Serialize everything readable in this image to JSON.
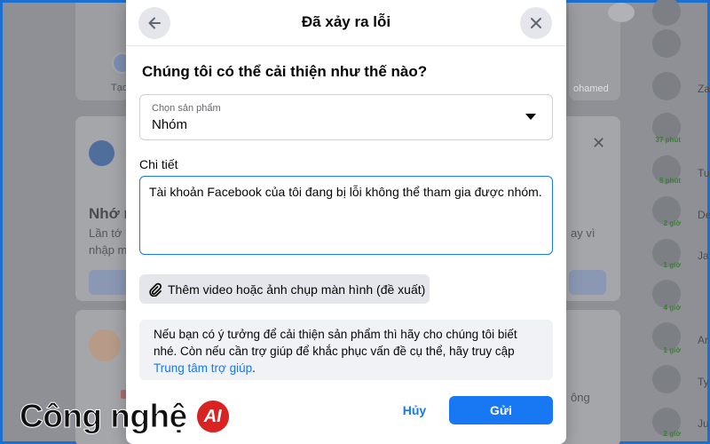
{
  "background": {
    "story_create_label": "Tạo",
    "story_name": "ohamed",
    "card_heading": "Nhớ m",
    "card_line1": "Lần tớ",
    "card_line2": "nhập m",
    "card_side_text": "ay vì",
    "card2_side_text": "ông",
    "contacts": [
      {
        "name": "",
        "time": ""
      },
      {
        "name": "Za",
        "time": ""
      },
      {
        "name": "",
        "time": "37 phút"
      },
      {
        "name": "Tu",
        "time": "5 phút"
      },
      {
        "name": "De",
        "time": "2 giờ"
      },
      {
        "name": "Ja",
        "time": "1 giờ"
      },
      {
        "name": "",
        "time": "4 giờ"
      },
      {
        "name": "Ar",
        "time": "1 giờ"
      },
      {
        "name": "Ty",
        "time": ""
      },
      {
        "name": "Ju",
        "time": "2 giờ"
      }
    ]
  },
  "modal": {
    "title": "Đã xảy ra lỗi",
    "question": "Chúng tôi có thể cải thiện như thế nào?",
    "product_select": {
      "label": "Chọn sản phẩm",
      "value": "Nhóm"
    },
    "details_label": "Chi tiết",
    "details_text": "Tài khoản Facebook của tôi đang bị lỗi không thể tham gia được nhóm.",
    "attach_label": "Thêm video hoặc ảnh chụp màn hình (đề xuất)",
    "info_text": "Nếu bạn có ý tưởng để cải thiện sản phẩm thì hãy cho chúng tôi biết nhé. Còn nếu cần trợ giúp để khắc phục vấn đề cụ thể, hãy truy cập ",
    "info_link": "Trung tâm trợ giúp",
    "info_end": ".",
    "cancel_label": "Hủy",
    "send_label": "Gửi"
  },
  "watermark": {
    "text": "Công nghệ",
    "logo": "AI"
  },
  "colors": {
    "primary": "#1877f2",
    "watermark_logo": "#d92323"
  }
}
